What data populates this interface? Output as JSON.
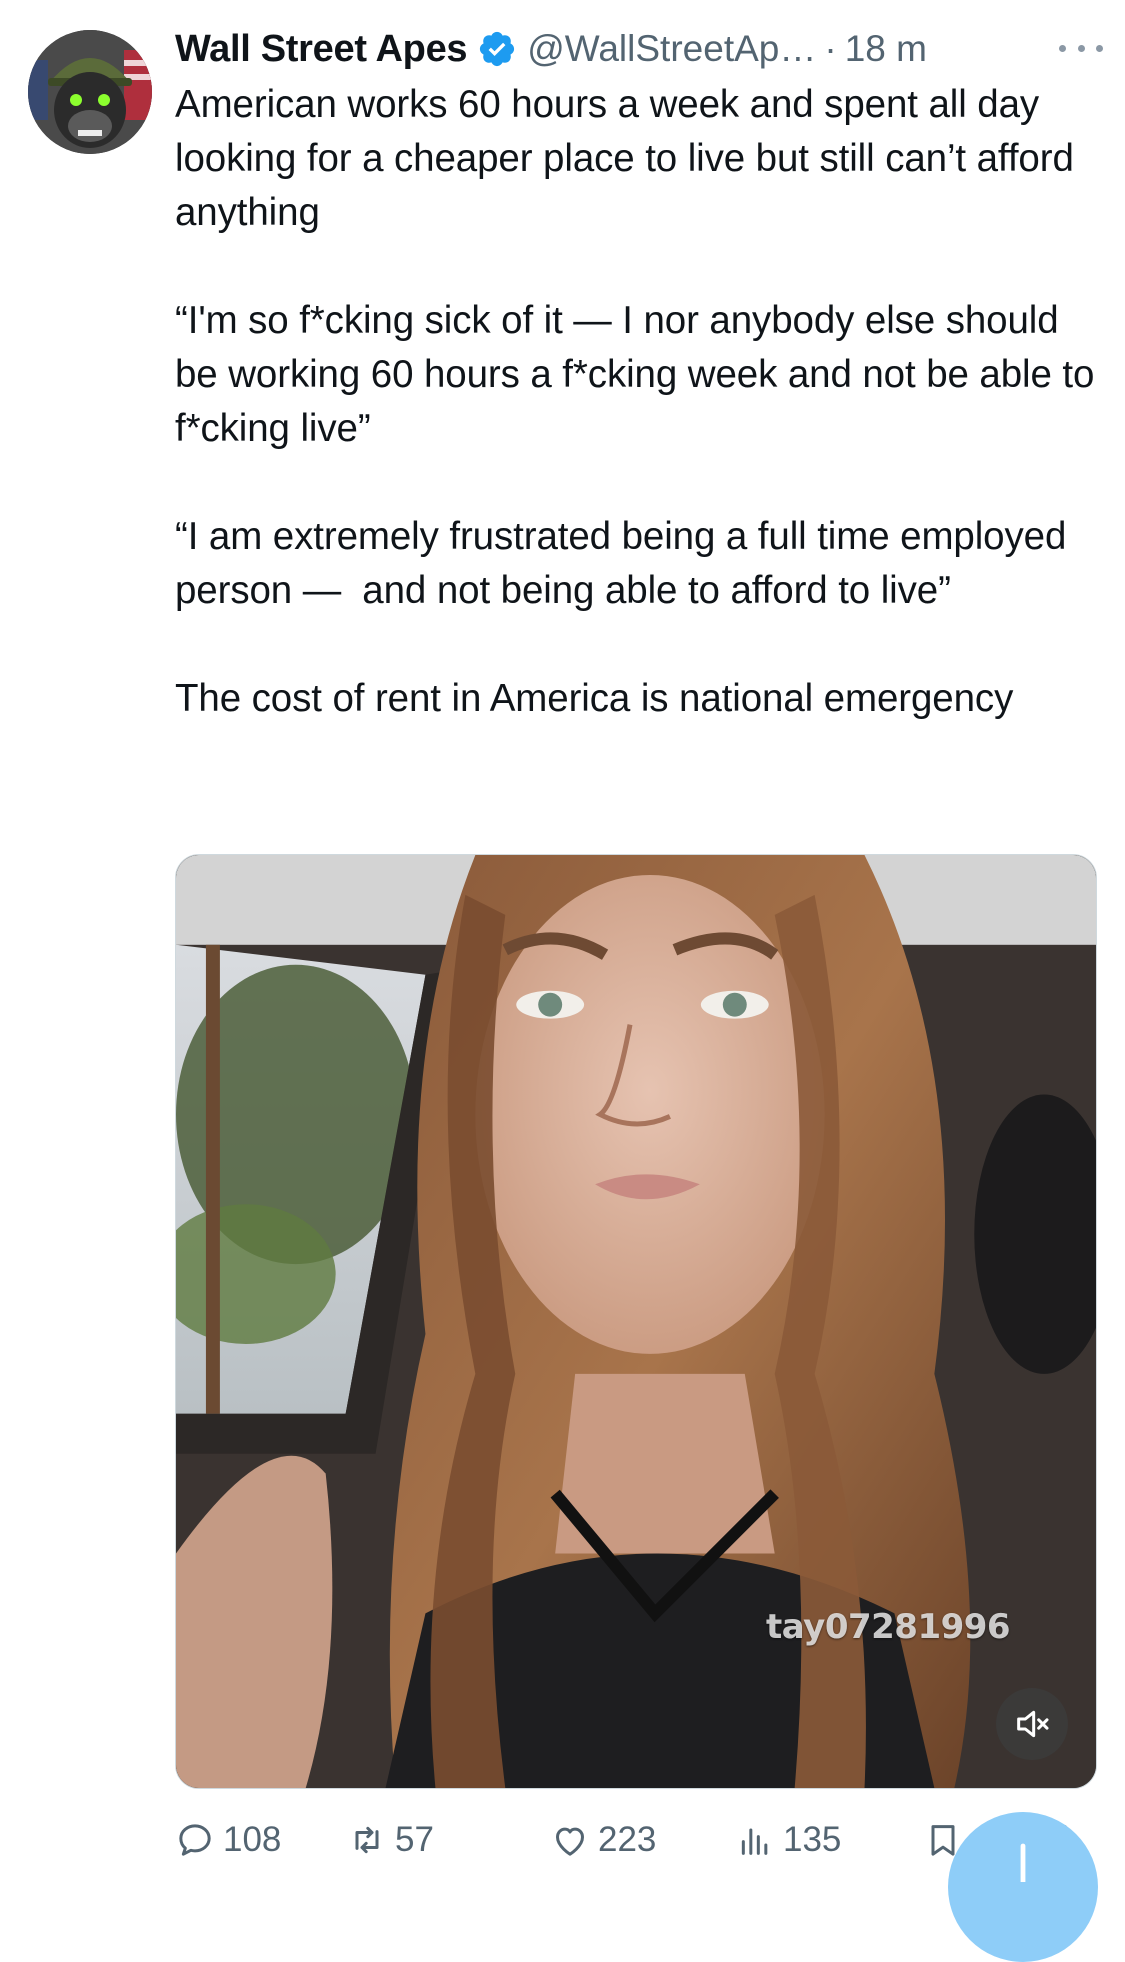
{
  "tweet": {
    "author": {
      "display_name": "Wall Street Apes",
      "handle": "@WallStreetAp…",
      "verified": true,
      "avatar_icon": "gorilla-soldier-avatar"
    },
    "separator": "·",
    "timestamp": "18 m",
    "text": "American works 60 hours a week and spent all day looking for a cheaper place to live but still can’t afford anything\n\n“I'm so f*cking sick of it — I nor anybody else should be working 60 hours a f*cking week and not be able to f*cking live”\n\n“I am extremely frustrated being a full time employed person —  and not being able to afford to live”\n\nThe cost of rent in America is national emergency",
    "media": {
      "type": "video",
      "watermark": "tay07281996",
      "muted": true
    },
    "actions": {
      "replies": "108",
      "reposts": "57",
      "likes": "223",
      "views": "135"
    }
  },
  "colors": {
    "text": "#0f1419",
    "secondary": "#536471",
    "verified": "#1d9bf0",
    "fab": "#8ecdf8"
  }
}
